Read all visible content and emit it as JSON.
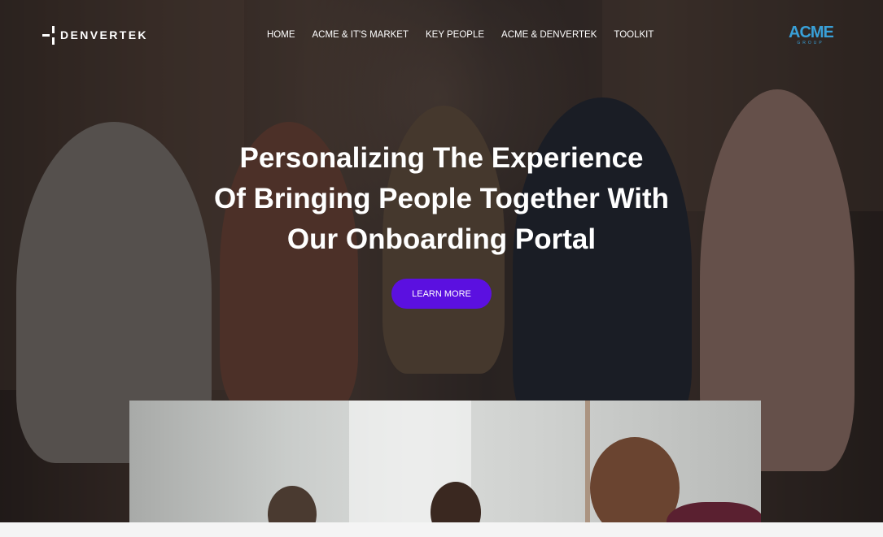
{
  "brand": {
    "name": "DENVERTEK"
  },
  "nav": {
    "items": [
      {
        "label": "HOME"
      },
      {
        "label": "ACME & IT'S MARKET"
      },
      {
        "label": "KEY PEOPLE"
      },
      {
        "label": "ACME & DENVERTEK"
      },
      {
        "label": "TOOLKIT"
      }
    ]
  },
  "partner_logo": {
    "word": "ACME",
    "sub": "GROUP"
  },
  "hero": {
    "headline_lines": [
      "Personalizing The Experience",
      "Of Bringing People Together With",
      "Our Onboarding Portal"
    ],
    "cta_label": "LEARN MORE"
  },
  "colors": {
    "accent": "#5b10e0",
    "partner": "#39a0d8"
  }
}
